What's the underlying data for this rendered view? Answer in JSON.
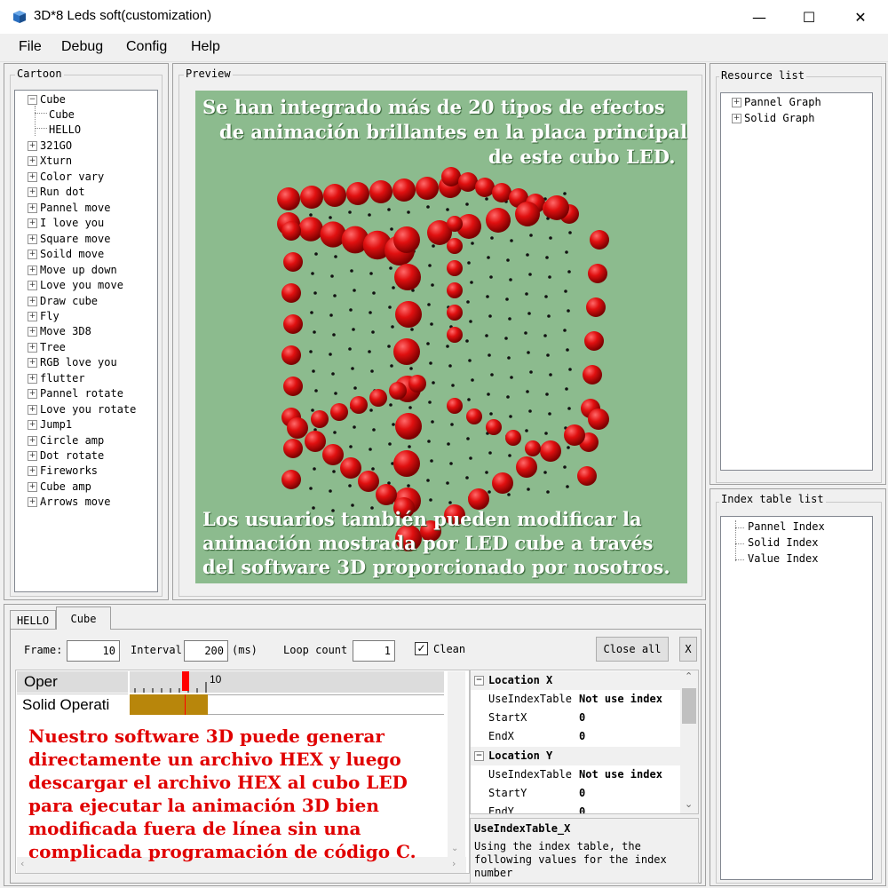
{
  "window": {
    "title": "3D*8 Leds soft(customization)",
    "minimize": "—",
    "maximize": "☐",
    "close": "✕"
  },
  "menu": [
    "File",
    "Debug",
    "Config",
    "Help"
  ],
  "cartoon": {
    "legend": "Cartoon",
    "root": "Cube",
    "children": [
      "Cube",
      "HELLO"
    ],
    "items": [
      "321GO",
      "Xturn",
      "Color vary",
      "Run dot",
      "Pannel move",
      "I love you",
      "Square move",
      "Soild move",
      "Move up down",
      "Love you move",
      "Draw cube",
      "Fly",
      "Move 3D8",
      "Tree",
      "RGB love you",
      "flutter",
      "Pannel rotate",
      "Love you rotate",
      "Jump1",
      "Circle amp",
      "Dot rotate",
      "Fireworks",
      "Cube amp",
      "Arrows move"
    ]
  },
  "preview": {
    "legend": "Preview",
    "top_text": [
      "Se han integrado más de 20 tipos de efectos",
      "de animación brillantes en la placa principal",
      "de este cubo LED."
    ],
    "bottom_text": [
      "Los usuarios también pueden modificar la",
      "animación mostrada por LED cube a través",
      "del software 3D proporcionado por nosotros."
    ],
    "led_color": "#e01010",
    "bg_color": "#8cbb8e"
  },
  "resource": {
    "legend": "Resource list",
    "items": [
      "Pannel Graph",
      "Solid Graph"
    ]
  },
  "index_table": {
    "legend": "Index table list",
    "items": [
      "Pannel Index",
      "Solid Index",
      "Value Index"
    ]
  },
  "tabs": [
    "HELLO",
    "Cube"
  ],
  "controls": {
    "frame_label": "Frame:",
    "frame_value": "10",
    "interval_label": "Interval",
    "interval_value": "200",
    "interval_unit": "(ms)",
    "loop_label": "Loop count",
    "loop_value": "1",
    "clean_label": "Clean",
    "clean_checked": true,
    "close_all": "Close all",
    "x_button": "X"
  },
  "timeline": {
    "row1": "Oper",
    "row2": "Solid Operati",
    "tick_label": "10"
  },
  "bottom_text": [
    "Nuestro software 3D puede generar",
    "directamente un archivo HEX y luego",
    "descargar el archivo HEX al cubo LED",
    "para ejecutar la animación 3D bien",
    "modificada fuera de línea sin una",
    "complicada programación de código C."
  ],
  "properties": {
    "cat1": "Location X",
    "cat2": "Location Y",
    "rows_x": [
      {
        "name": "UseIndexTable",
        "value": "Not use index"
      },
      {
        "name": "StartX",
        "value": "0"
      },
      {
        "name": "EndX",
        "value": "0"
      }
    ],
    "rows_y": [
      {
        "name": "UseIndexTable",
        "value": "Not use index"
      },
      {
        "name": "StartY",
        "value": "0"
      },
      {
        "name": "EndY",
        "value": "0"
      }
    ],
    "desc_title": "UseIndexTable_X",
    "desc_text": [
      "Using the index table, the",
      "following values for the index",
      "number"
    ]
  }
}
